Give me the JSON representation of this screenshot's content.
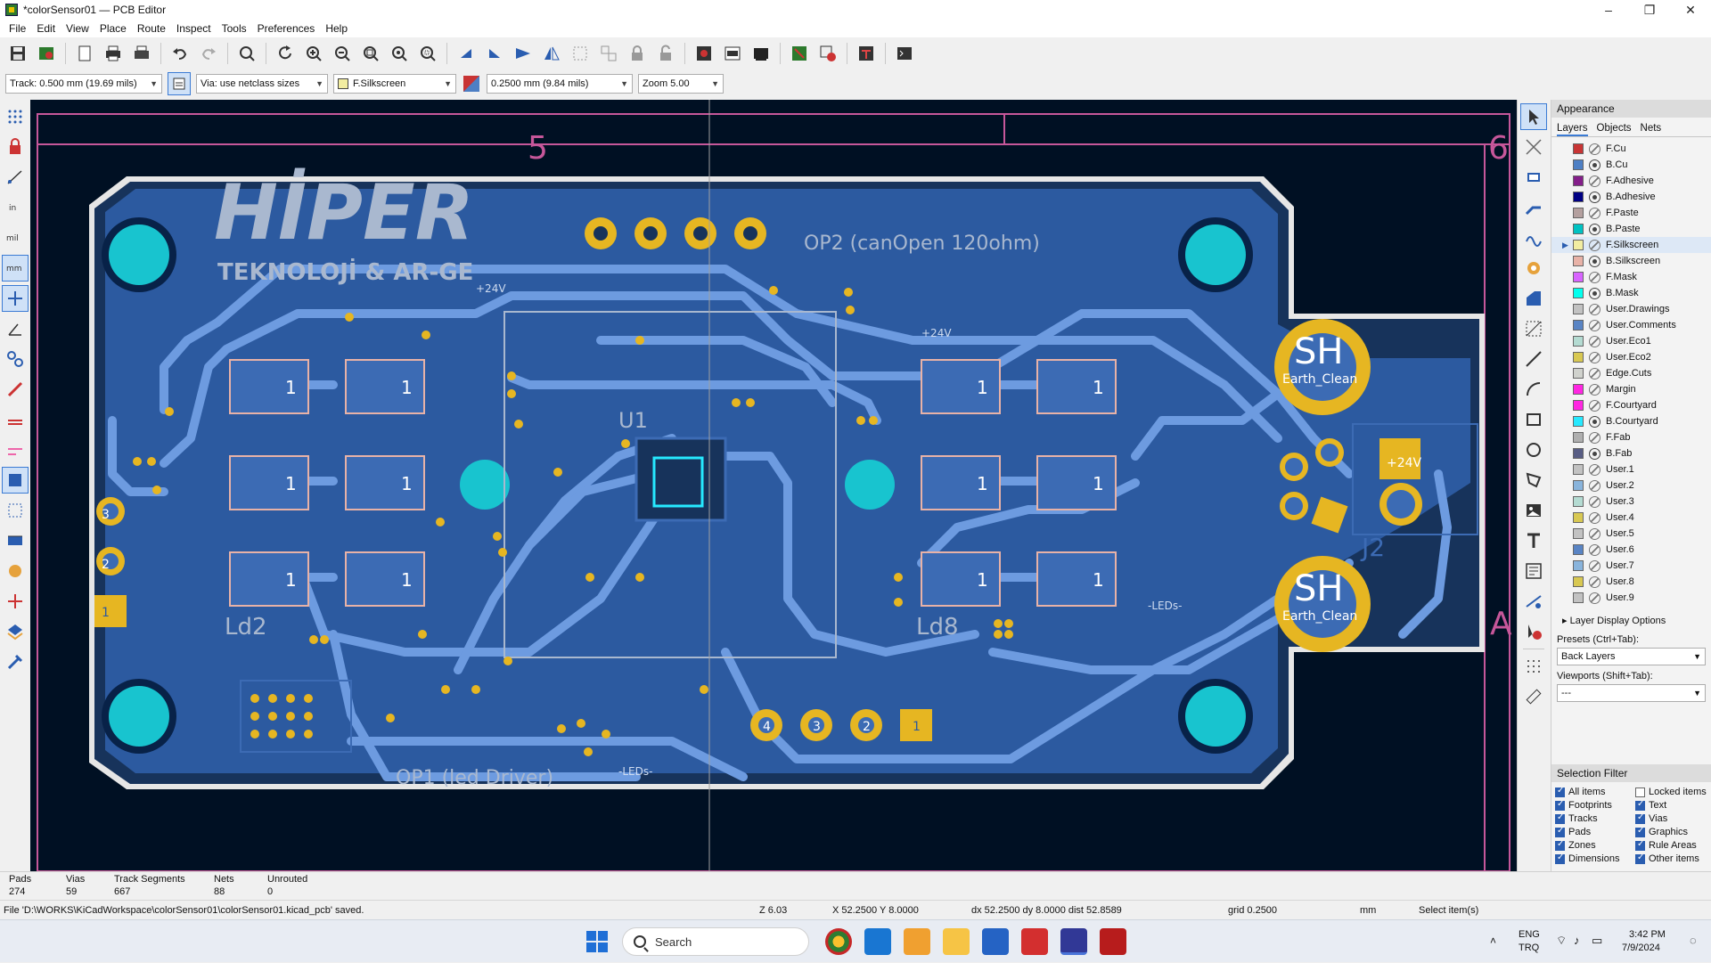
{
  "window": {
    "title": "*colorSensor01 — PCB Editor",
    "controls": [
      "–",
      "❐",
      "✕"
    ]
  },
  "menu": [
    "File",
    "Edit",
    "View",
    "Place",
    "Route",
    "Inspect",
    "Tools",
    "Preferences",
    "Help"
  ],
  "auxbar": {
    "track": "Track: 0.500 mm (19.69 mils)",
    "via": "Via: use netclass sizes",
    "layer": "F.Silkscreen",
    "grid": "0.2500 mm (9.84 mils)",
    "zoom": "Zoom 5.00"
  },
  "canvas": {
    "sheet_cols": [
      "5",
      "6"
    ],
    "sheet_row": "A",
    "logo": "HİPER",
    "logo_sub": "TEKNOLOJİ & AR-GE",
    "labels": {
      "op2": "OP2 (canOpen 120ohm)",
      "op1": "OP1 (led Driver)",
      "ld2": "Ld2",
      "ld8": "Ld8",
      "j2": "J2",
      "u1": "U1",
      "sh": "SH",
      "earth": "Earth_Clean",
      "net24": "+24V",
      "leds": "-LEDs-",
      "pad1": "1",
      "pad2": "2",
      "pad3": "3",
      "pad4": "4"
    }
  },
  "appearance": {
    "title": "Appearance",
    "tabs": [
      "Layers",
      "Objects",
      "Nets"
    ],
    "layers": [
      {
        "name": "F.Cu",
        "color": "#c83434",
        "vis": "pen"
      },
      {
        "name": "B.Cu",
        "color": "#4d7fc4",
        "vis": "eye"
      },
      {
        "name": "F.Adhesive",
        "color": "#841e8a",
        "vis": "pen"
      },
      {
        "name": "B.Adhesive",
        "color": "#000084",
        "vis": "eye"
      },
      {
        "name": "F.Paste",
        "color": "#b4a09f",
        "vis": "pen"
      },
      {
        "name": "B.Paste",
        "color": "#00c2c2",
        "vis": "eye"
      },
      {
        "name": "F.Silkscreen",
        "color": "#f2eda1",
        "vis": "pen",
        "active": true
      },
      {
        "name": "B.Silkscreen",
        "color": "#e8b2a7",
        "vis": "eye"
      },
      {
        "name": "F.Mask",
        "color": "#d864ff",
        "vis": "pen"
      },
      {
        "name": "B.Mask",
        "color": "#02ffee",
        "vis": "eye"
      },
      {
        "name": "User.Drawings",
        "color": "#c2c2c2",
        "vis": "pen"
      },
      {
        "name": "User.Comments",
        "color": "#5984c4",
        "vis": "pen"
      },
      {
        "name": "User.Eco1",
        "color": "#b4dbd2",
        "vis": "pen"
      },
      {
        "name": "User.Eco2",
        "color": "#d8c852",
        "vis": "pen"
      },
      {
        "name": "Edge.Cuts",
        "color": "#d0d2cd",
        "vis": "pen"
      },
      {
        "name": "Margin",
        "color": "#ff26e2",
        "vis": "pen"
      },
      {
        "name": "F.Courtyard",
        "color": "#ff26e2",
        "vis": "pen"
      },
      {
        "name": "B.Courtyard",
        "color": "#26e9ff",
        "vis": "eye"
      },
      {
        "name": "F.Fab",
        "color": "#afafaf",
        "vis": "pen"
      },
      {
        "name": "B.Fab",
        "color": "#585d84",
        "vis": "eye"
      },
      {
        "name": "User.1",
        "color": "#c2c2c2",
        "vis": "pen"
      },
      {
        "name": "User.2",
        "color": "#89b4dc",
        "vis": "pen"
      },
      {
        "name": "User.3",
        "color": "#b4dbd2",
        "vis": "pen"
      },
      {
        "name": "User.4",
        "color": "#d8c852",
        "vis": "pen"
      },
      {
        "name": "User.5",
        "color": "#c2c2c2",
        "vis": "pen"
      },
      {
        "name": "User.6",
        "color": "#5984c4",
        "vis": "pen"
      },
      {
        "name": "User.7",
        "color": "#89b4dc",
        "vis": "pen"
      },
      {
        "name": "User.8",
        "color": "#d8c852",
        "vis": "pen"
      },
      {
        "name": "User.9",
        "color": "#c2c2c2",
        "vis": "pen"
      }
    ],
    "layer_display_options": "Layer Display Options",
    "presets_label": "Presets (Ctrl+Tab):",
    "presets_value": "Back Layers",
    "viewports_label": "Viewports (Shift+Tab):",
    "viewports_value": "---",
    "selection_filter": "Selection Filter",
    "filters": [
      {
        "label": "All items",
        "checked": true
      },
      {
        "label": "Locked items",
        "checked": false
      },
      {
        "label": "Footprints",
        "checked": true
      },
      {
        "label": "Text",
        "checked": true
      },
      {
        "label": "Tracks",
        "checked": true
      },
      {
        "label": "Vias",
        "checked": true
      },
      {
        "label": "Pads",
        "checked": true
      },
      {
        "label": "Graphics",
        "checked": true
      },
      {
        "label": "Zones",
        "checked": true
      },
      {
        "label": "Rule Areas",
        "checked": true
      },
      {
        "label": "Dimensions",
        "checked": true
      },
      {
        "label": "Other items",
        "checked": true
      }
    ]
  },
  "stats": [
    {
      "label": "Pads",
      "value": "274"
    },
    {
      "label": "Vias",
      "value": "59"
    },
    {
      "label": "Track Segments",
      "value": "667"
    },
    {
      "label": "Nets",
      "value": "88"
    },
    {
      "label": "Unrouted",
      "value": "0"
    }
  ],
  "status": {
    "message": "File 'D:\\WORKS\\KiCadWorkspace\\colorSensor01\\colorSensor01.kicad_pcb' saved.",
    "zoom": "Z 6.03",
    "coords": "X 52.2500  Y 8.0000",
    "delta": "dx 52.2500  dy 8.0000  dist 52.8589",
    "grid": "grid 0.2500",
    "units": "mm",
    "mode": "Select item(s)"
  },
  "taskbar": {
    "search": "Search",
    "lang1": "ENG",
    "lang2": "TRQ",
    "time": "3:42 PM",
    "date": "7/9/2024"
  }
}
